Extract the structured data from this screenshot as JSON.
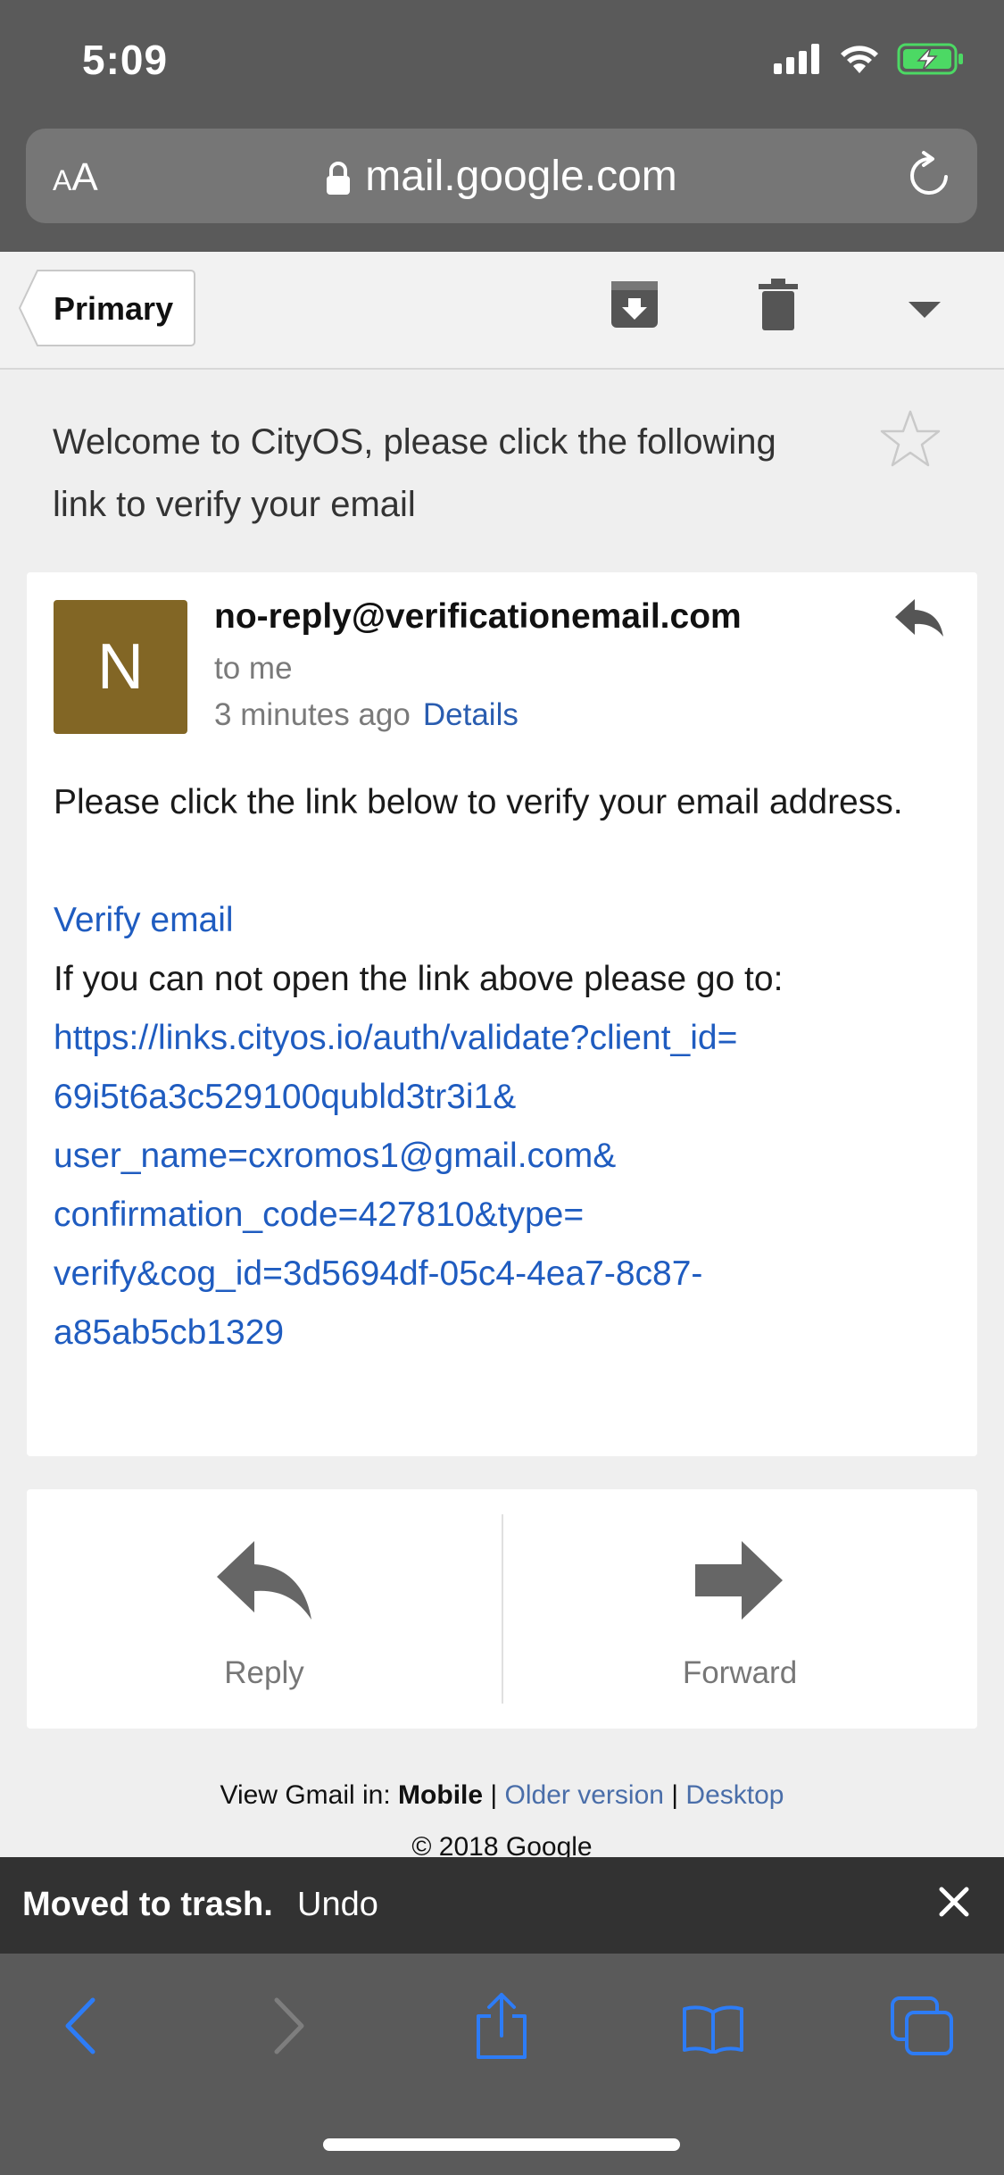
{
  "status_bar": {
    "time": "5:09"
  },
  "browser": {
    "aa_label": "AA",
    "url": "mail.google.com"
  },
  "toolbar": {
    "back_label": "Primary"
  },
  "email": {
    "subject": "Welcome to CityOS, please click the following link to verify your email",
    "avatar_letter": "N",
    "sender": "no-reply@verificationemail.com",
    "to_label": "to me",
    "time_ago": "3 minutes ago",
    "details_label": "Details",
    "body_line1": "Please click the link below to verify your email address.",
    "verify_link_text": "Verify email",
    "fallback_text": "If you can not open the link above please go to:",
    "fallback_url_lines": [
      "https://links.cityos.io/auth/validate?client_id=",
      "69i5t6a3c529100qubld3tr3i1&",
      "user_name=cxromos1@gmail.com&",
      "confirmation_code=427810&type=",
      "verify&cog_id=3d5694df-05c4-4ea7-8c87-",
      "a85ab5cb1329"
    ]
  },
  "actions": {
    "reply_label": "Reply",
    "forward_label": "Forward"
  },
  "footer": {
    "view_in": "View Gmail in:",
    "mobile": "Mobile",
    "older": "Older version",
    "desktop": "Desktop",
    "sep": "|",
    "copyright": "© 2018 Google"
  },
  "snackbar": {
    "message": "Moved to trash.",
    "undo": "Undo"
  },
  "colors": {
    "accent_link": "#1f5cc0",
    "avatar_bg": "#826625",
    "battery": "#4cd964",
    "safari_blue": "#2d7cf6"
  }
}
